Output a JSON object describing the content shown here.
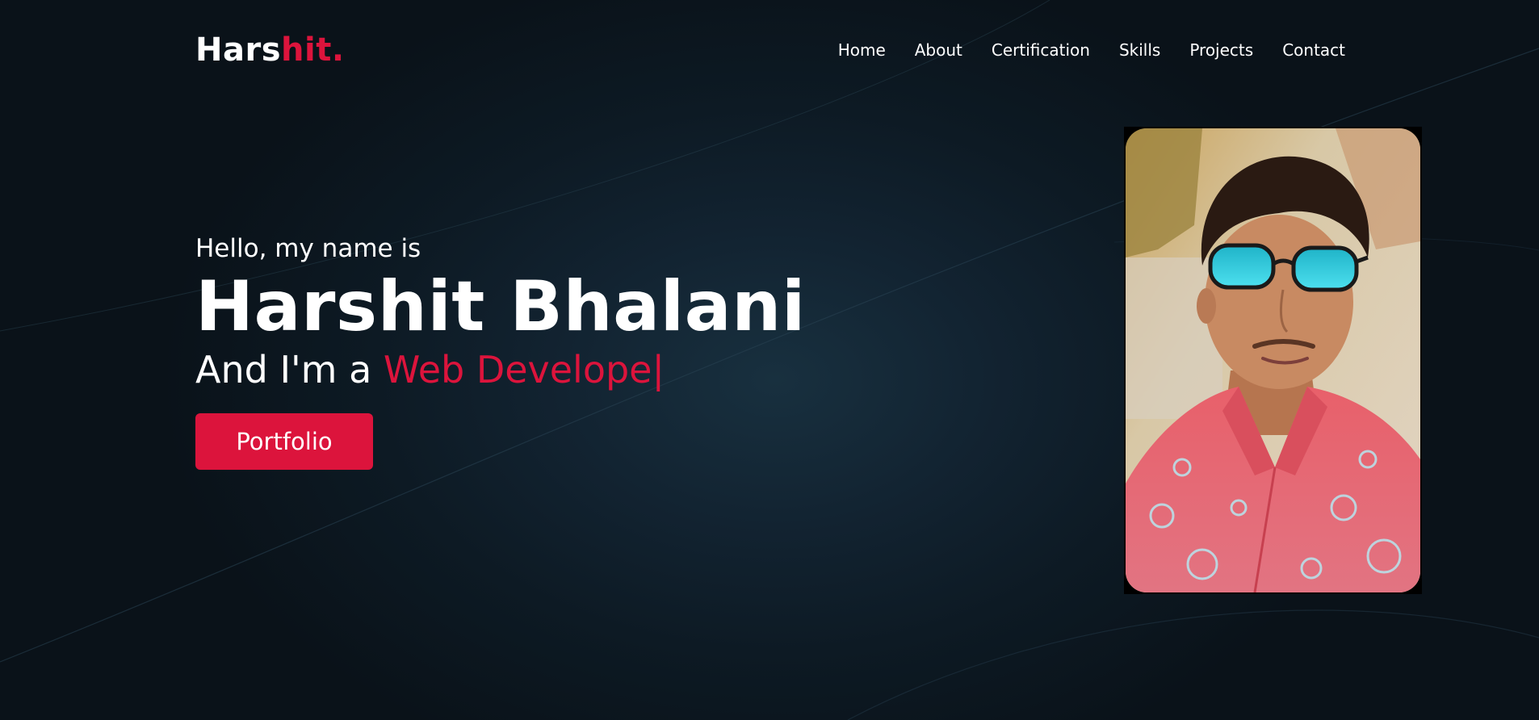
{
  "brand": {
    "logo_main": "Hars",
    "logo_accent": "hit."
  },
  "nav": {
    "items": [
      "Home",
      "About",
      "Certification",
      "Skills",
      "Projects",
      "Contact"
    ]
  },
  "hero": {
    "greeting": "Hello, my name is",
    "name": "Harshit Bhalani",
    "role_prefix": "And I'm a ",
    "role_typed": "Web Develope",
    "cursor": "|",
    "button_label": "Portfolio"
  },
  "colors": {
    "accent": "#dc143c",
    "background": "#0b141c",
    "text": "#ffffff"
  },
  "images": {
    "profile": "profile-photo"
  }
}
